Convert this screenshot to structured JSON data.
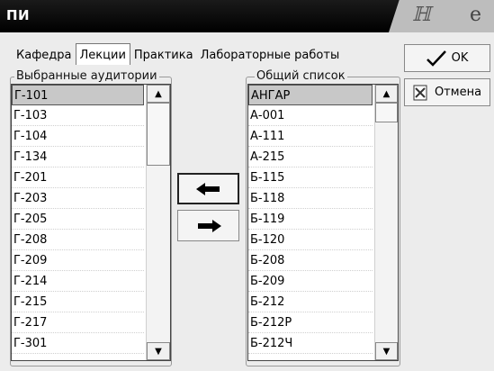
{
  "window": {
    "title": "ПИ"
  },
  "tabs": [
    "Кафедра",
    "Лекции",
    "Практика",
    "Лабораторные работы"
  ],
  "active_tab": "Лекции",
  "selected_group": {
    "label": "Выбранные аудитории",
    "items": [
      "Г-101",
      "Г-103",
      "Г-104",
      "Г-134",
      "Г-201",
      "Г-203",
      "Г-205",
      "Г-208",
      "Г-209",
      "Г-214",
      "Г-215",
      "Г-217",
      "Г-301"
    ],
    "selected_item": "Г-101"
  },
  "general_group": {
    "label": "Общий список",
    "items": [
      "АНГАР",
      "А-001",
      "А-111",
      "А-215",
      "Б-115",
      "Б-118",
      "Б-119",
      "Б-120",
      "Б-208",
      "Б-209",
      "Б-212",
      "Б-212Р",
      "Б-212Ч"
    ],
    "selected_item": "АНГАР"
  },
  "buttons": {
    "ok": "OK",
    "cancel": "Отмена"
  },
  "icons": {
    "move_left": "arrow-left-icon",
    "move_right": "arrow-right-icon",
    "ok": "checkmark-icon",
    "cancel": "cancel-icon"
  }
}
